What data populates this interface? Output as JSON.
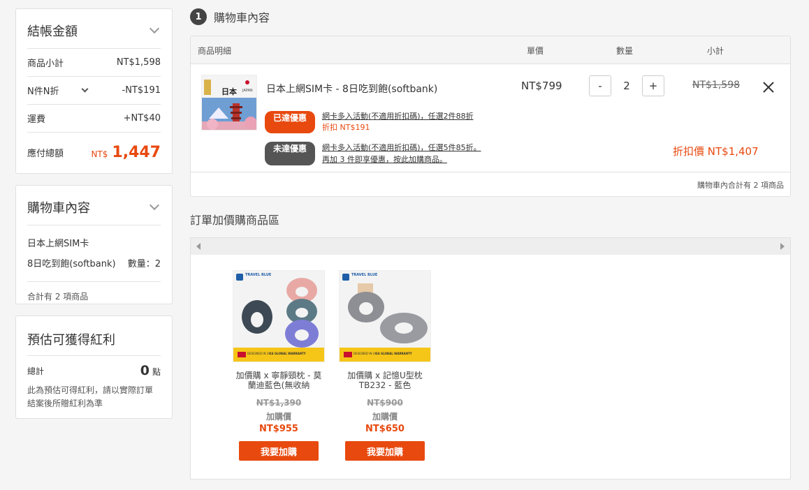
{
  "summary": {
    "title": "結帳金額",
    "subtotal_label": "商品小計",
    "subtotal_value": "NT$1,598",
    "discount_label": "N件N折",
    "discount_value": "-NT$191",
    "shipping_label": "運費",
    "shipping_value": "+NT$40",
    "total_label": "應付總額",
    "total_currency": "NT$",
    "total_value": "1,447"
  },
  "cart_side": {
    "title": "購物車內容",
    "item_line1": "日本上網SIM卡",
    "item_line2": "8日吃到飽(softbank)",
    "item_qty": "數量：2",
    "total_text": "合計有 2 項商品"
  },
  "rewards": {
    "title": "預估可獲得紅利",
    "total_label": "總計",
    "points_value": "0",
    "points_unit": "點",
    "note": "此為預估可得紅利，請以實際訂單結案後所贈紅利為準"
  },
  "step": {
    "number": "1",
    "title": "購物車內容"
  },
  "cart_table": {
    "headers": {
      "detail": "商品明細",
      "unit_price": "單價",
      "quantity": "數量",
      "subtotal": "小計"
    },
    "item": {
      "name": "日本上網SIM卡 - 8日吃到飽(softbank)",
      "image_label_top": "日本",
      "image_label_en": "JAPAN",
      "unit_price": "NT$799",
      "quantity": "2",
      "minus": "-",
      "plus": "+",
      "subtotal_original": "NT$1,598",
      "promo1_tag": "已達優惠",
      "promo1_text": "網卡多入活動(不適用折扣碼)，任選2件88折",
      "promo1_discount": "折扣 NT$191",
      "promo2_tag": "未達優惠",
      "promo2_text": "網卡多入活動(不適用折扣碼)，任選5件85折。",
      "promo2_hint": "再加 3 件即享優惠，按此加購商品。",
      "discounted_price": "折扣價 NT$1,407"
    },
    "footer": "購物車內合計有 2 項商品"
  },
  "addon": {
    "title": "訂單加價購商品區",
    "products": [
      {
        "name": "加價購 x 寧靜頸枕 - 莫蘭迪藍色(無收納",
        "original_price": "NT$1,390",
        "addon_label": "加購價",
        "price": "NT$955",
        "button": "我要加購",
        "brand": "TRAVEL BLUE",
        "banner_left": "DESIGNED IN UK",
        "banner_right": "24 GLOBAL WARRANTY"
      },
      {
        "name": "加價購 x 記憶U型枕 TB232 - 藍色",
        "original_price": "NT$900",
        "addon_label": "加購價",
        "price": "NT$650",
        "button": "我要加購",
        "brand": "TRAVEL BLUE",
        "banner_left": "DESIGNED IN UK",
        "banner_right": "24 GLOBAL WARRANTY"
      }
    ]
  },
  "colors": {
    "accent": "#e8490f",
    "dark_tag": "#555555",
    "border": "#e0e0e0"
  }
}
